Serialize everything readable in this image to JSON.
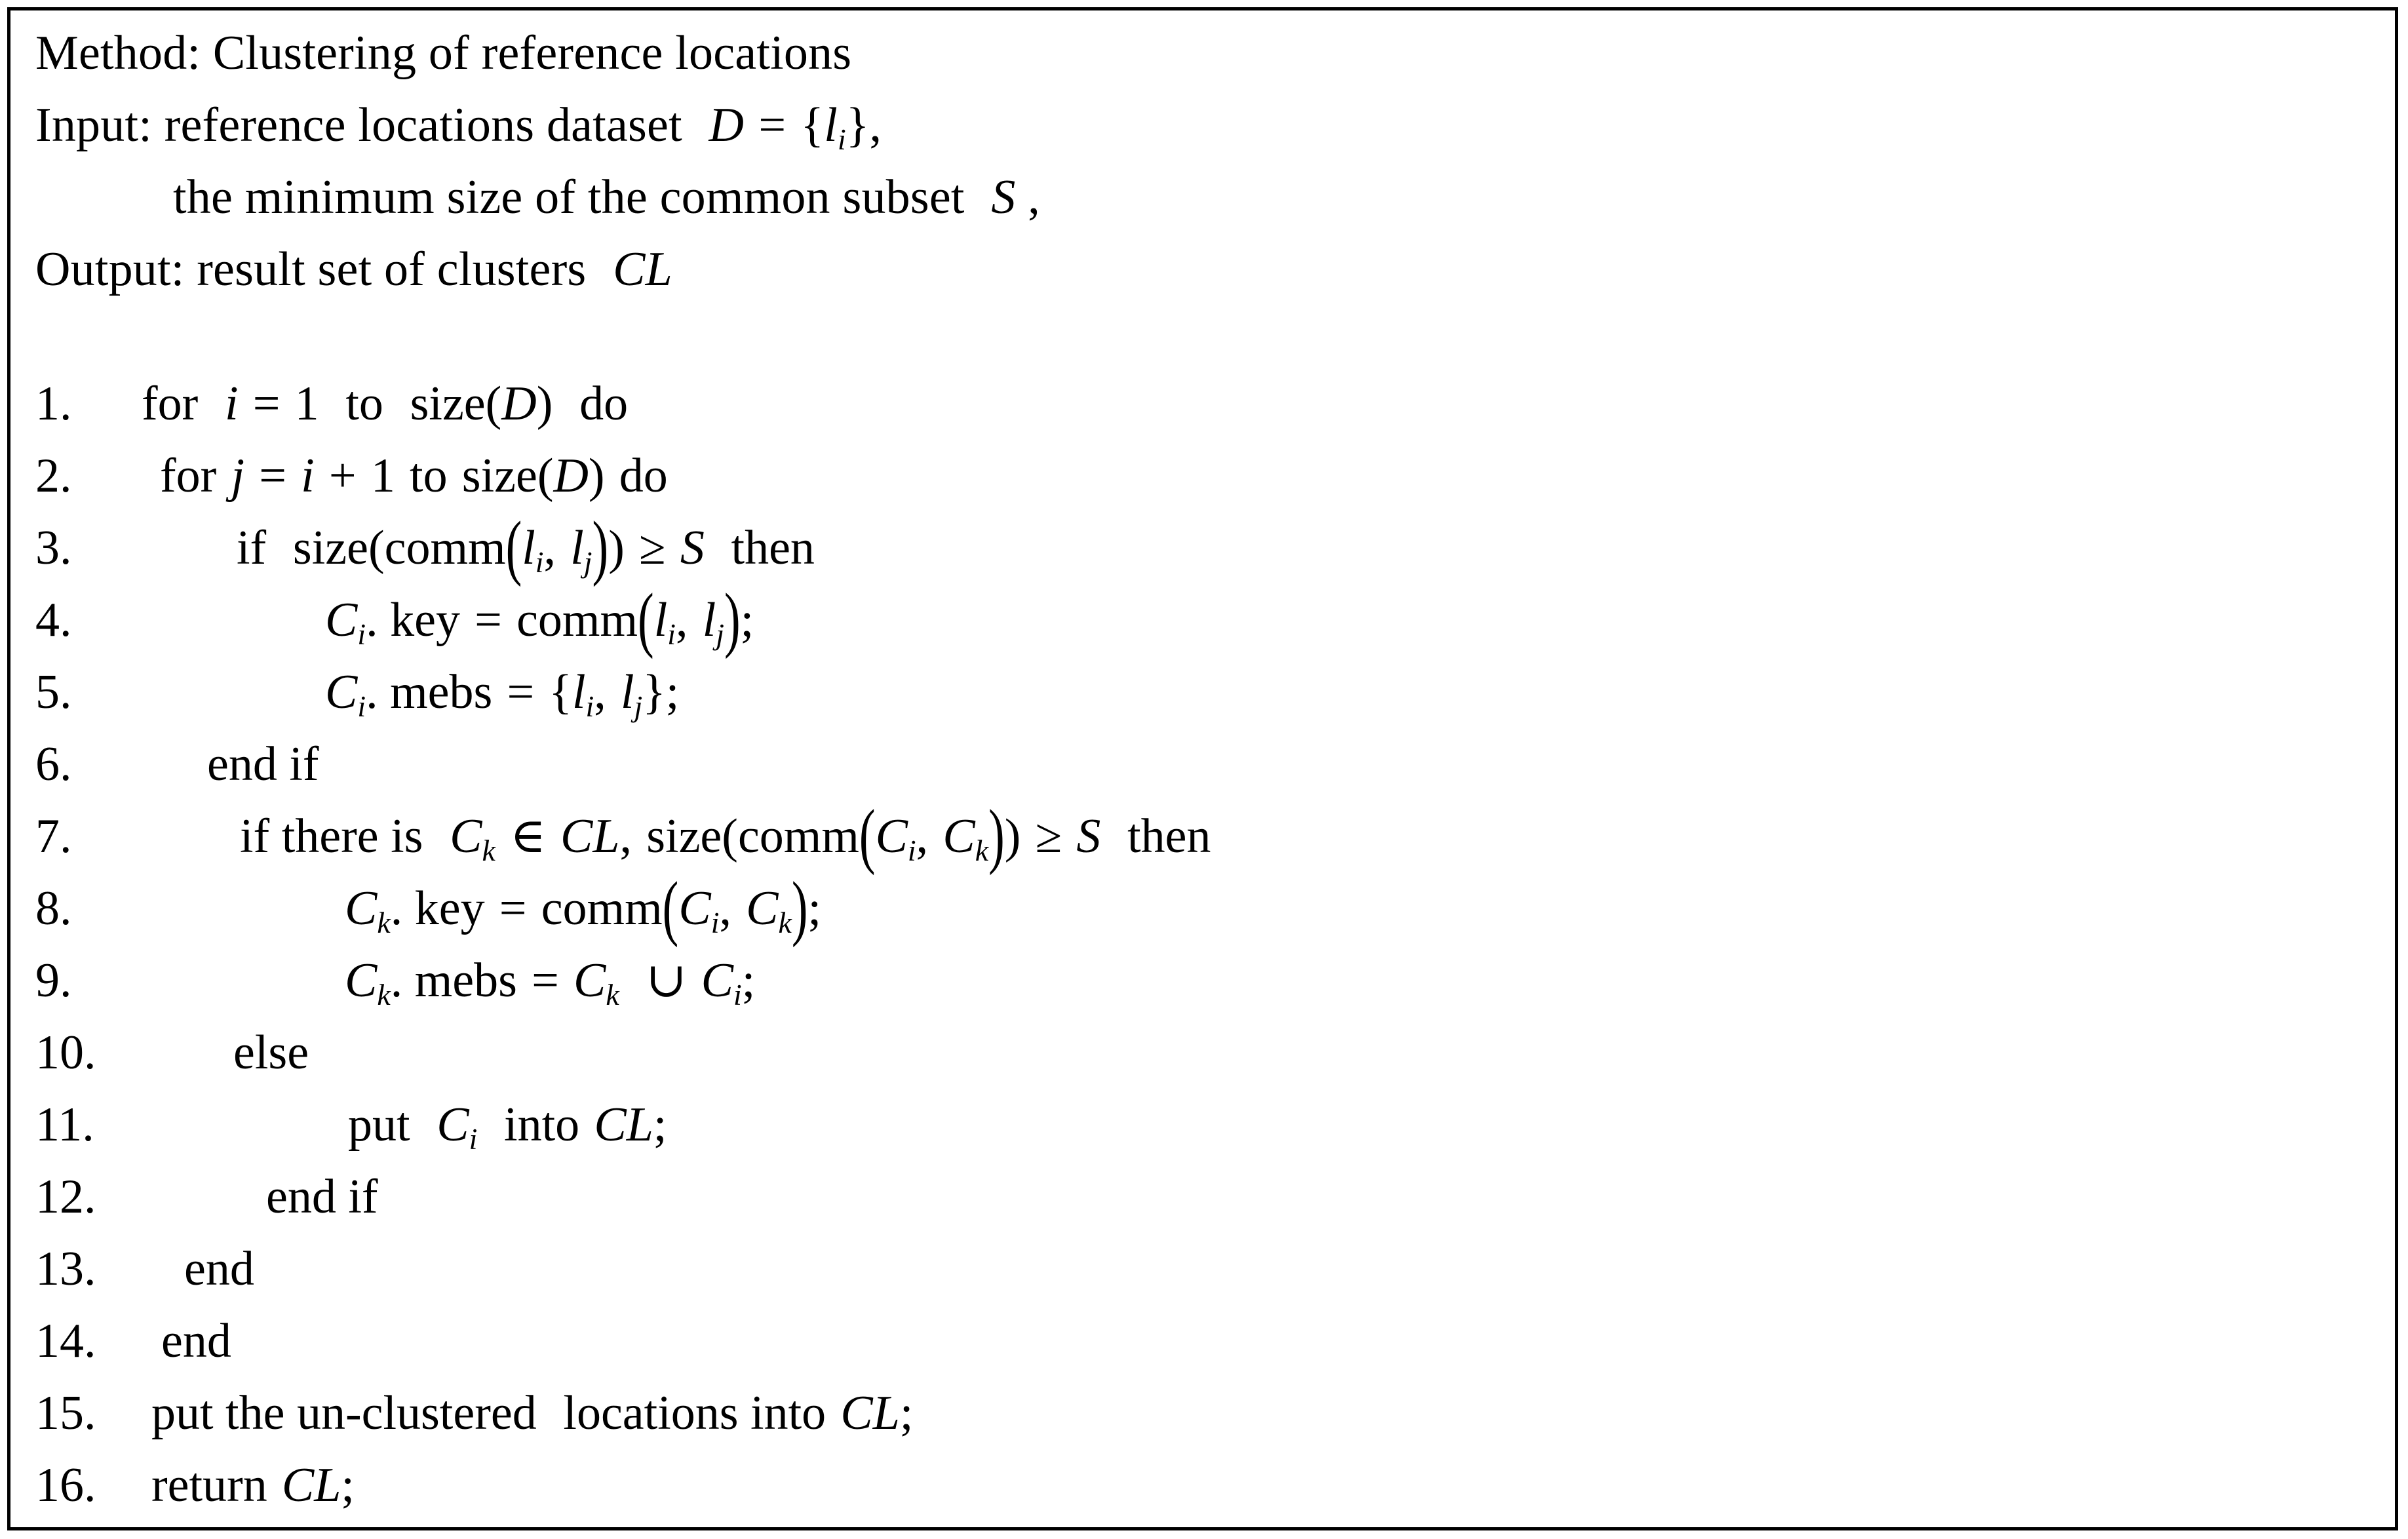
{
  "algorithm": {
    "header": {
      "method_line": "Method: Clustering of reference locations",
      "input_line_prefix": "Input: reference locations dataset",
      "input_line_math": "D = {lᵢ},",
      "input_line_2": "the minimum size of the common subset",
      "input_line_2_math": "S ,",
      "output_line_prefix": "Output: result set of clusters",
      "output_line_math": "CL"
    },
    "steps": [
      {
        "number": "1.",
        "indent": 200,
        "text": "for  i = 1  to  size(D)  do"
      },
      {
        "number": "2.",
        "indent": 228,
        "text": "for j = i + 1 to size(D) do"
      },
      {
        "number": "3.",
        "indent": 345,
        "text": "if  size(comm(lᵢ, lⱼ)) ≥ S  then"
      },
      {
        "number": "4.",
        "indent": 480,
        "text": "Cᵢ. key = comm(lᵢ, lⱼ);"
      },
      {
        "number": "5.",
        "indent": 480,
        "text": "Cᵢ. mebs = {lᵢ, lⱼ};"
      },
      {
        "number": "6.",
        "indent": 300,
        "text": "end if"
      },
      {
        "number": "7.",
        "indent": 350,
        "text": "if there is Cₖ ∈ CL, size(comm(Cᵢ, Cₖ)) ≥ S  then"
      },
      {
        "number": "8.",
        "indent": 510,
        "text": "Cₖ. key = comm(Cᵢ, Cₖ);"
      },
      {
        "number": "9.",
        "indent": 510,
        "text": "Cₖ. mebs = Cₖ ∪ Cᵢ;"
      },
      {
        "number": "10.",
        "indent": 340,
        "text": "else"
      },
      {
        "number": "11.",
        "indent": 515,
        "text": "put  Cᵢ  into CL;"
      },
      {
        "number": "12.",
        "indent": 390,
        "text": "end if"
      },
      {
        "number": "13.",
        "indent": 265,
        "text": "end"
      },
      {
        "number": "14.",
        "indent": 230,
        "text": "end"
      },
      {
        "number": "15.",
        "indent": 215,
        "text": "put the un-clustered  locations into CL;"
      },
      {
        "number": "16.",
        "indent": 215,
        "text": "return CL;"
      }
    ],
    "colors": {
      "border": "#000000",
      "text": "#000000",
      "background": "#ffffff"
    },
    "layout": {
      "first_step_top": 563,
      "step_spacing": 110
    }
  }
}
